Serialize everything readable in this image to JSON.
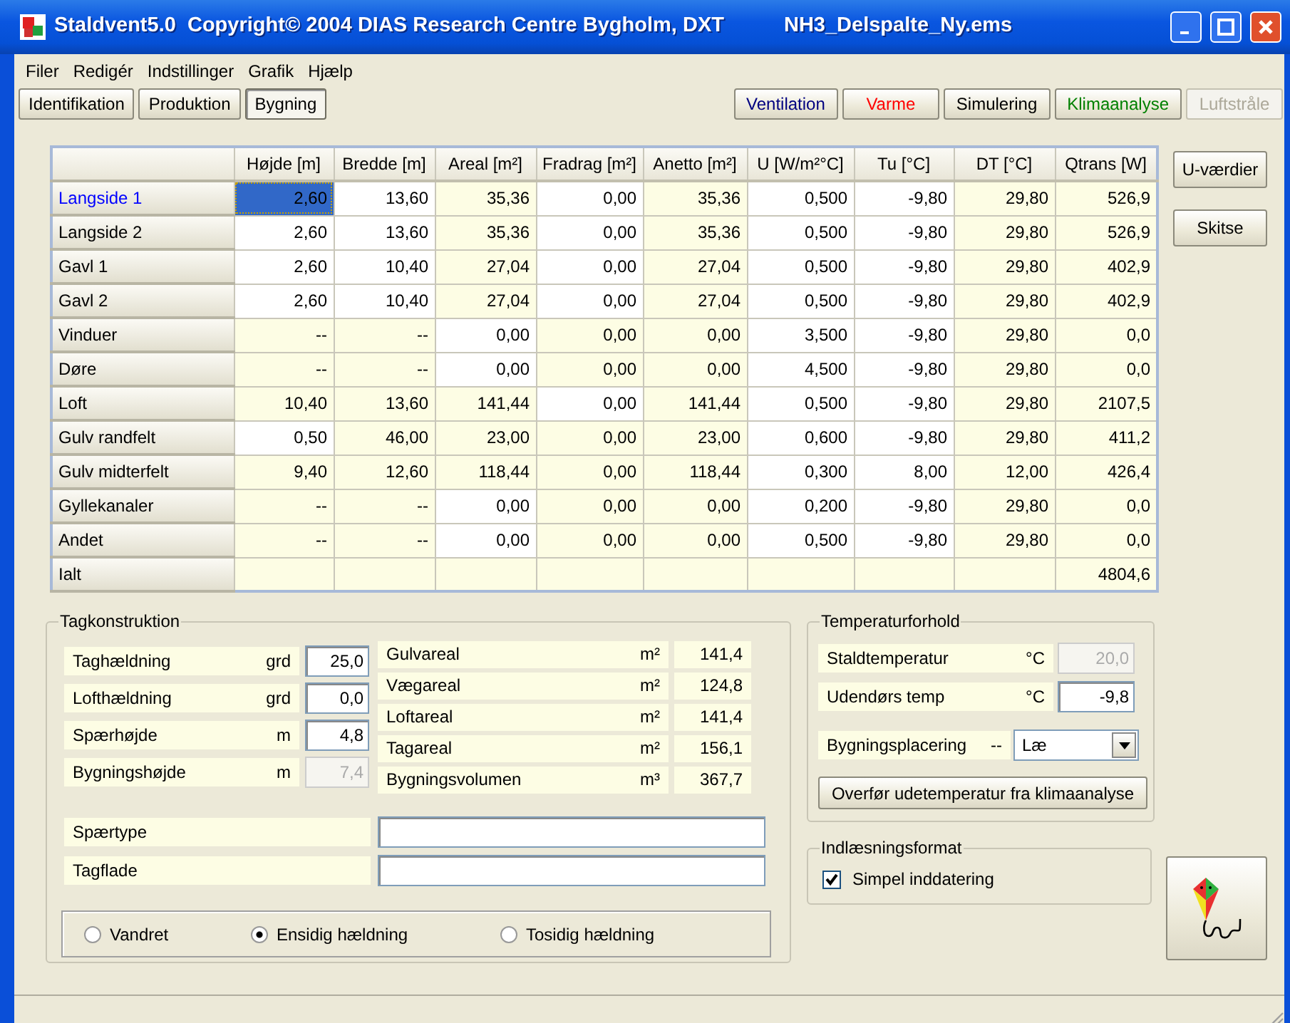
{
  "window": {
    "title": "Staldvent5.0  Copyright© 2004 DIAS Research Centre Bygholm, DXT",
    "file": "NH3_Delspalte_Ny.ems"
  },
  "menu": [
    "Filer",
    "Redigér",
    "Indstillinger",
    "Grafik",
    "Hjælp"
  ],
  "tabs": [
    {
      "label": "Identifikation",
      "selected": false
    },
    {
      "label": "Produktion",
      "selected": false
    },
    {
      "label": "Bygning",
      "selected": true
    }
  ],
  "modules": [
    {
      "label": "Ventilation",
      "color": "#000080",
      "disabled": false
    },
    {
      "label": "Varme",
      "color": "#ff0000",
      "disabled": false
    },
    {
      "label": "Simulering",
      "color": "#000000",
      "disabled": false
    },
    {
      "label": "Klimaanalyse",
      "color": "#008000",
      "disabled": false
    },
    {
      "label": "Luftstråle",
      "color": "#aca899",
      "disabled": true
    }
  ],
  "table": {
    "columns": [
      "Højde [m]",
      "Bredde [m]",
      "Areal [m²]",
      "Fradrag [m²]",
      "Anetto [m²]",
      "U [W/m²°C]",
      "Tu [°C]",
      "DT [°C]",
      "Qtrans [W]"
    ],
    "rows": [
      {
        "label": "Langside 1",
        "selected": true,
        "cells": [
          {
            "value": "2,60",
            "editable": true,
            "selected": true
          },
          {
            "value": "13,60",
            "editable": true,
            "selected": false
          },
          {
            "value": "35,36",
            "editable": false,
            "selected": false
          },
          {
            "value": "0,00",
            "editable": true,
            "selected": false
          },
          {
            "value": "35,36",
            "editable": false,
            "selected": false
          },
          {
            "value": "0,500",
            "editable": true,
            "selected": false
          },
          {
            "value": "-9,80",
            "editable": true,
            "selected": false
          },
          {
            "value": "29,80",
            "editable": false,
            "selected": false
          },
          {
            "value": "526,9",
            "editable": false,
            "selected": false
          }
        ]
      },
      {
        "label": "Langside 2",
        "selected": false,
        "cells": [
          {
            "value": "2,60",
            "editable": true,
            "selected": false
          },
          {
            "value": "13,60",
            "editable": true,
            "selected": false
          },
          {
            "value": "35,36",
            "editable": false,
            "selected": false
          },
          {
            "value": "0,00",
            "editable": true,
            "selected": false
          },
          {
            "value": "35,36",
            "editable": false,
            "selected": false
          },
          {
            "value": "0,500",
            "editable": true,
            "selected": false
          },
          {
            "value": "-9,80",
            "editable": true,
            "selected": false
          },
          {
            "value": "29,80",
            "editable": false,
            "selected": false
          },
          {
            "value": "526,9",
            "editable": false,
            "selected": false
          }
        ]
      },
      {
        "label": "Gavl 1",
        "selected": false,
        "cells": [
          {
            "value": "2,60",
            "editable": true,
            "selected": false
          },
          {
            "value": "10,40",
            "editable": true,
            "selected": false
          },
          {
            "value": "27,04",
            "editable": false,
            "selected": false
          },
          {
            "value": "0,00",
            "editable": true,
            "selected": false
          },
          {
            "value": "27,04",
            "editable": false,
            "selected": false
          },
          {
            "value": "0,500",
            "editable": true,
            "selected": false
          },
          {
            "value": "-9,80",
            "editable": true,
            "selected": false
          },
          {
            "value": "29,80",
            "editable": false,
            "selected": false
          },
          {
            "value": "402,9",
            "editable": false,
            "selected": false
          }
        ]
      },
      {
        "label": "Gavl 2",
        "selected": false,
        "cells": [
          {
            "value": "2,60",
            "editable": true,
            "selected": false
          },
          {
            "value": "10,40",
            "editable": true,
            "selected": false
          },
          {
            "value": "27,04",
            "editable": false,
            "selected": false
          },
          {
            "value": "0,00",
            "editable": true,
            "selected": false
          },
          {
            "value": "27,04",
            "editable": false,
            "selected": false
          },
          {
            "value": "0,500",
            "editable": true,
            "selected": false
          },
          {
            "value": "-9,80",
            "editable": true,
            "selected": false
          },
          {
            "value": "29,80",
            "editable": false,
            "selected": false
          },
          {
            "value": "402,9",
            "editable": false,
            "selected": false
          }
        ]
      },
      {
        "label": "Vinduer",
        "selected": false,
        "cells": [
          {
            "value": "--",
            "editable": false,
            "selected": false
          },
          {
            "value": "--",
            "editable": false,
            "selected": false
          },
          {
            "value": "0,00",
            "editable": true,
            "selected": false
          },
          {
            "value": "0,00",
            "editable": false,
            "selected": false
          },
          {
            "value": "0,00",
            "editable": false,
            "selected": false
          },
          {
            "value": "3,500",
            "editable": true,
            "selected": false
          },
          {
            "value": "-9,80",
            "editable": true,
            "selected": false
          },
          {
            "value": "29,80",
            "editable": false,
            "selected": false
          },
          {
            "value": "0,0",
            "editable": false,
            "selected": false
          }
        ]
      },
      {
        "label": "Døre",
        "selected": false,
        "cells": [
          {
            "value": "--",
            "editable": false,
            "selected": false
          },
          {
            "value": "--",
            "editable": false,
            "selected": false
          },
          {
            "value": "0,00",
            "editable": true,
            "selected": false
          },
          {
            "value": "0,00",
            "editable": false,
            "selected": false
          },
          {
            "value": "0,00",
            "editable": false,
            "selected": false
          },
          {
            "value": "4,500",
            "editable": true,
            "selected": false
          },
          {
            "value": "-9,80",
            "editable": true,
            "selected": false
          },
          {
            "value": "29,80",
            "editable": false,
            "selected": false
          },
          {
            "value": "0,0",
            "editable": false,
            "selected": false
          }
        ]
      },
      {
        "label": "Loft",
        "selected": false,
        "cells": [
          {
            "value": "10,40",
            "editable": false,
            "selected": false
          },
          {
            "value": "13,60",
            "editable": false,
            "selected": false
          },
          {
            "value": "141,44",
            "editable": false,
            "selected": false
          },
          {
            "value": "0,00",
            "editable": true,
            "selected": false
          },
          {
            "value": "141,44",
            "editable": false,
            "selected": false
          },
          {
            "value": "0,500",
            "editable": true,
            "selected": false
          },
          {
            "value": "-9,80",
            "editable": true,
            "selected": false
          },
          {
            "value": "29,80",
            "editable": false,
            "selected": false
          },
          {
            "value": "2107,5",
            "editable": false,
            "selected": false
          }
        ]
      },
      {
        "label": "Gulv randfelt",
        "selected": false,
        "cells": [
          {
            "value": "0,50",
            "editable": true,
            "selected": false
          },
          {
            "value": "46,00",
            "editable": false,
            "selected": false
          },
          {
            "value": "23,00",
            "editable": false,
            "selected": false
          },
          {
            "value": "0,00",
            "editable": false,
            "selected": false
          },
          {
            "value": "23,00",
            "editable": false,
            "selected": false
          },
          {
            "value": "0,600",
            "editable": true,
            "selected": false
          },
          {
            "value": "-9,80",
            "editable": true,
            "selected": false
          },
          {
            "value": "29,80",
            "editable": false,
            "selected": false
          },
          {
            "value": "411,2",
            "editable": false,
            "selected": false
          }
        ]
      },
      {
        "label": "Gulv midterfelt",
        "selected": false,
        "cells": [
          {
            "value": "9,40",
            "editable": false,
            "selected": false
          },
          {
            "value": "12,60",
            "editable": false,
            "selected": false
          },
          {
            "value": "118,44",
            "editable": false,
            "selected": false
          },
          {
            "value": "0,00",
            "editable": false,
            "selected": false
          },
          {
            "value": "118,44",
            "editable": false,
            "selected": false
          },
          {
            "value": "0,300",
            "editable": true,
            "selected": false
          },
          {
            "value": "8,00",
            "editable": true,
            "selected": false
          },
          {
            "value": "12,00",
            "editable": false,
            "selected": false
          },
          {
            "value": "426,4",
            "editable": false,
            "selected": false
          }
        ]
      },
      {
        "label": "Gyllekanaler",
        "selected": false,
        "cells": [
          {
            "value": "--",
            "editable": false,
            "selected": false
          },
          {
            "value": "--",
            "editable": false,
            "selected": false
          },
          {
            "value": "0,00",
            "editable": true,
            "selected": false
          },
          {
            "value": "0,00",
            "editable": false,
            "selected": false
          },
          {
            "value": "0,00",
            "editable": false,
            "selected": false
          },
          {
            "value": "0,200",
            "editable": true,
            "selected": false
          },
          {
            "value": "-9,80",
            "editable": true,
            "selected": false
          },
          {
            "value": "29,80",
            "editable": false,
            "selected": false
          },
          {
            "value": "0,0",
            "editable": false,
            "selected": false
          }
        ]
      },
      {
        "label": "Andet",
        "selected": false,
        "cells": [
          {
            "value": "--",
            "editable": false,
            "selected": false
          },
          {
            "value": "--",
            "editable": false,
            "selected": false
          },
          {
            "value": "0,00",
            "editable": true,
            "selected": false
          },
          {
            "value": "0,00",
            "editable": false,
            "selected": false
          },
          {
            "value": "0,00",
            "editable": false,
            "selected": false
          },
          {
            "value": "0,500",
            "editable": true,
            "selected": false
          },
          {
            "value": "-9,80",
            "editable": true,
            "selected": false
          },
          {
            "value": "29,80",
            "editable": false,
            "selected": false
          },
          {
            "value": "0,0",
            "editable": false,
            "selected": false
          }
        ]
      },
      {
        "label": "Ialt",
        "selected": false,
        "cells": [
          null,
          null,
          null,
          null,
          null,
          null,
          null,
          null,
          {
            "value": "4804,6",
            "editable": false,
            "selected": false
          }
        ]
      }
    ]
  },
  "side_buttons": [
    "U-værdier",
    "Skitse"
  ],
  "tagkonstruktion": {
    "title": "Tagkonstruktion",
    "inputs": [
      {
        "label": "Taghældning",
        "unit": "grd",
        "value": "25,0",
        "disabled": false
      },
      {
        "label": "Lofthældning",
        "unit": "grd",
        "value": "0,0",
        "disabled": false
      },
      {
        "label": "Spærhøjde",
        "unit": "m",
        "value": "4,8",
        "disabled": false
      },
      {
        "label": "Bygningshøjde",
        "unit": "m",
        "value": "7,4",
        "disabled": true
      }
    ],
    "results": [
      {
        "label": "Gulvareal",
        "unit": "m²",
        "value": "141,4"
      },
      {
        "label": "Vægareal",
        "unit": "m²",
        "value": "124,8"
      },
      {
        "label": "Loftareal",
        "unit": "m²",
        "value": "141,4"
      },
      {
        "label": "Tagareal",
        "unit": "m²",
        "value": "156,1"
      },
      {
        "label": "Bygningsvolumen",
        "unit": "m³",
        "value": "367,7"
      }
    ],
    "text_fields": [
      {
        "label": "Spærtype"
      },
      {
        "label": "Tagflade"
      }
    ],
    "roof_type": [
      {
        "label": "Vandret",
        "selected": false
      },
      {
        "label": "Ensidig hældning",
        "selected": true
      },
      {
        "label": "Tosidig hældning",
        "selected": false
      }
    ]
  },
  "temperaturforhold": {
    "title": "Temperaturforhold",
    "inputs": [
      {
        "label": "Staldtemperatur",
        "unit": "°C",
        "value": "20,0",
        "disabled": true
      },
      {
        "label": "Udendørs temp",
        "unit": "°C",
        "value": "-9,8",
        "disabled": false
      }
    ],
    "placement": {
      "label": "Bygningsplacering",
      "unit": "--",
      "value": "Læ"
    },
    "button": "Overfør udetemperatur fra klimaanalyse"
  },
  "indlaesningsformat": {
    "title": "Indlæsningsformat",
    "checkbox": {
      "label": "Simpel inddatering",
      "checked": true
    }
  }
}
